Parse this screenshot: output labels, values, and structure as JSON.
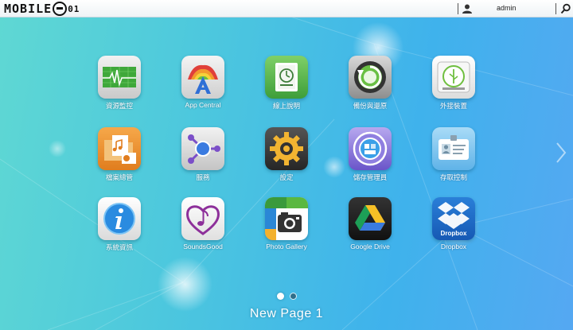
{
  "topbar": {
    "logo_text": "MOBILE",
    "logo_suffix": "01",
    "username": "admin"
  },
  "apps": [
    {
      "label": "資源監控",
      "icon": "resource-monitor-icon"
    },
    {
      "label": "App Central",
      "icon": "app-central-icon"
    },
    {
      "label": "線上說明",
      "icon": "online-help-icon"
    },
    {
      "label": "備份與還原",
      "icon": "backup-restore-icon"
    },
    {
      "label": "外接裝置",
      "icon": "external-device-icon"
    },
    {
      "label": "檔案總管",
      "icon": "file-explorer-icon"
    },
    {
      "label": "服務",
      "icon": "services-icon"
    },
    {
      "label": "設定",
      "icon": "settings-gear-icon"
    },
    {
      "label": "儲存管理員",
      "icon": "storage-manager-icon"
    },
    {
      "label": "存取控制",
      "icon": "access-control-icon"
    },
    {
      "label": "系統資訊",
      "icon": "system-info-icon"
    },
    {
      "label": "SoundsGood",
      "icon": "soundsgood-icon"
    },
    {
      "label": "Photo Gallery",
      "icon": "photo-gallery-icon"
    },
    {
      "label": "Google Drive",
      "icon": "google-drive-icon"
    },
    {
      "label": "Dropbox",
      "icon": "dropbox-icon"
    }
  ],
  "dropbox_tile_text": "Dropbox",
  "pager": {
    "page_count": 2,
    "active_page": 1,
    "title": "New Page 1"
  },
  "colors": {
    "background_start": "#5fd8d3",
    "background_end": "#55a8f2",
    "active_dot": "#ffffff",
    "inactive_dot": "#2f6f8a"
  }
}
